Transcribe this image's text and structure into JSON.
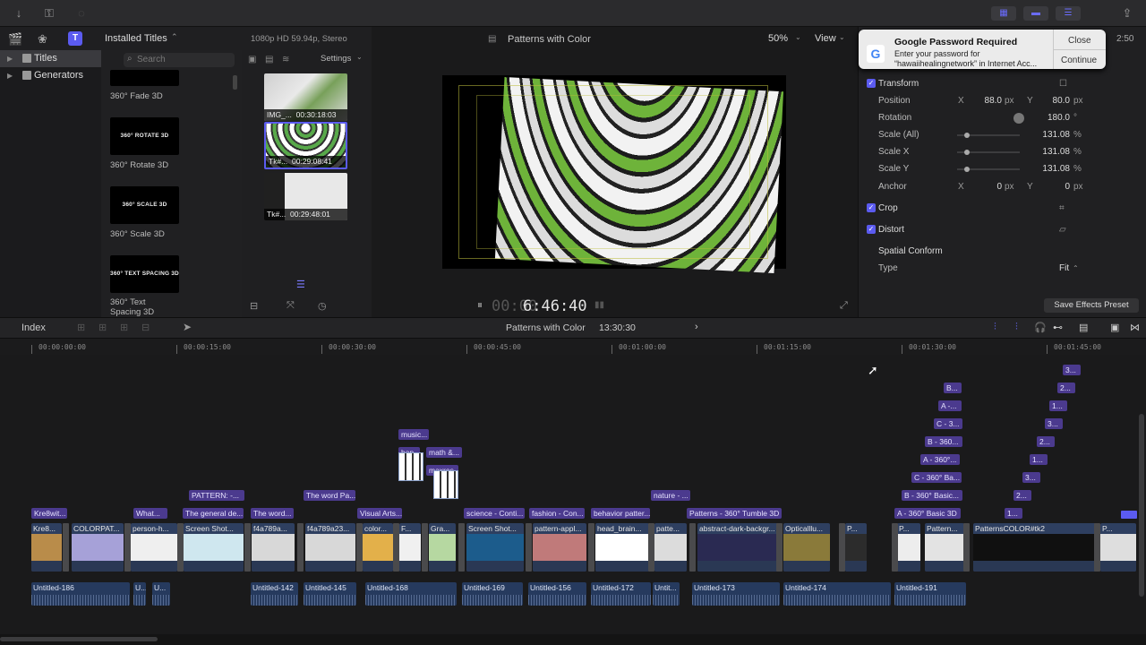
{
  "toolbar": {
    "time_right": "2:50"
  },
  "library": {
    "browser_title": "Installed Titles",
    "search_placeholder": "Search",
    "categories": [
      {
        "label": "Titles"
      },
      {
        "label": "Generators"
      }
    ]
  },
  "titles_browser": [
    {
      "label": "360° Fade 3D",
      "thumb": ""
    },
    {
      "label": "360° Rotate 3D",
      "thumb": "360° ROTATE 3D"
    },
    {
      "label": "360° Scale 3D",
      "thumb": "360° SCALE 3D"
    },
    {
      "label": "360° Text Spacing 3D",
      "thumb": "360° TEXT SPACING 3D"
    }
  ],
  "clips_panel": {
    "settings_label": "Settings",
    "clips": [
      {
        "name": "IMG_...",
        "duration": "00:30:18:03"
      },
      {
        "name": "Tk#...",
        "duration": "00:29:08:41"
      },
      {
        "name": "Tk#...",
        "duration": "00:29:48:01"
      }
    ]
  },
  "viewer": {
    "format": "1080p HD 59.94p, Stereo",
    "title": "Patterns with Color",
    "zoom": "50%",
    "view_label": "View",
    "timecode_dim": "00:00",
    "timecode": "6:46:40"
  },
  "notification": {
    "title": "Google Password Required",
    "line1": "Enter your password for",
    "line2": "“hawaiihealingnetwork” in Internet Acc...",
    "close": "Close",
    "continue": "Continue"
  },
  "inspector": {
    "transform": "Transform",
    "position_label": "Position",
    "position_x": "88.0",
    "position_y": "80.0",
    "rotation_label": "Rotation",
    "rotation_val": "180.0",
    "scale_all_label": "Scale (All)",
    "scale_all_val": "131.08",
    "scale_x_label": "Scale X",
    "scale_x_val": "131.08",
    "scale_y_label": "Scale Y",
    "scale_y_val": "131.08",
    "anchor_label": "Anchor",
    "anchor_x": "0",
    "anchor_y": "0",
    "x": "X",
    "y": "Y",
    "px": "px",
    "pct": "%",
    "deg": "°",
    "crop": "Crop",
    "distort": "Distort",
    "spatial_conform": "Spatial Conform",
    "type_label": "Type",
    "type_val": "Fit",
    "save_preset": "Save Effects Preset"
  },
  "timeline": {
    "index_label": "Index",
    "project": "Patterns with Color",
    "duration": "13:30:30",
    "ruler": [
      "00:00:00:00",
      "00:00:15:00",
      "00:00:30:00",
      "00:00:45:00",
      "00:01:00:00",
      "00:01:15:00",
      "00:01:30:00",
      "00:01:45:00"
    ],
    "titles": [
      "Kre8wit...",
      "What...",
      "PATTERN: -...",
      "The general de...",
      "The word...",
      "The word Pa...",
      "Visual Arts...",
      "music...",
      "han...",
      "math &...",
      "maxres...",
      "science - Conti...",
      "fashion - Con...",
      "behavior patter...",
      "nature - ...",
      "Patterns - 360° Tumble 3D",
      "A - 360° Basic 3D",
      "B - 360° Basic...",
      "C - 360° Ba...",
      "A - 360°...",
      "B - 360...",
      "C - 3...",
      "A -...",
      "B...",
      "1...",
      "2...",
      "3...",
      "1...",
      "2...",
      "3...",
      "1...",
      "2...",
      "3..."
    ],
    "video": [
      "Kre8...",
      "COLORPAT...",
      "person-h...",
      "Screen Shot...",
      "f4a789a...",
      "f4a789a23...",
      "color...",
      "F...",
      "Gra...",
      "Screen Shot...",
      "pattern-appl...",
      "head_brain...",
      "patte...",
      "abstract-dark-backgr...",
      "Opticalllu...",
      "P...",
      "P...",
      "Pattern...",
      "PatternsCOLOR#tk2",
      "P..."
    ],
    "audio": [
      "Untitled-186",
      "U...",
      "U...",
      "Untitled-142",
      "Untitled-145",
      "Untitled-168",
      "Untitled-169",
      "Untitled-156",
      "Untitled-172",
      "Untit...",
      "Untitled-173",
      "Untitled-174",
      "Untitled-191"
    ]
  }
}
